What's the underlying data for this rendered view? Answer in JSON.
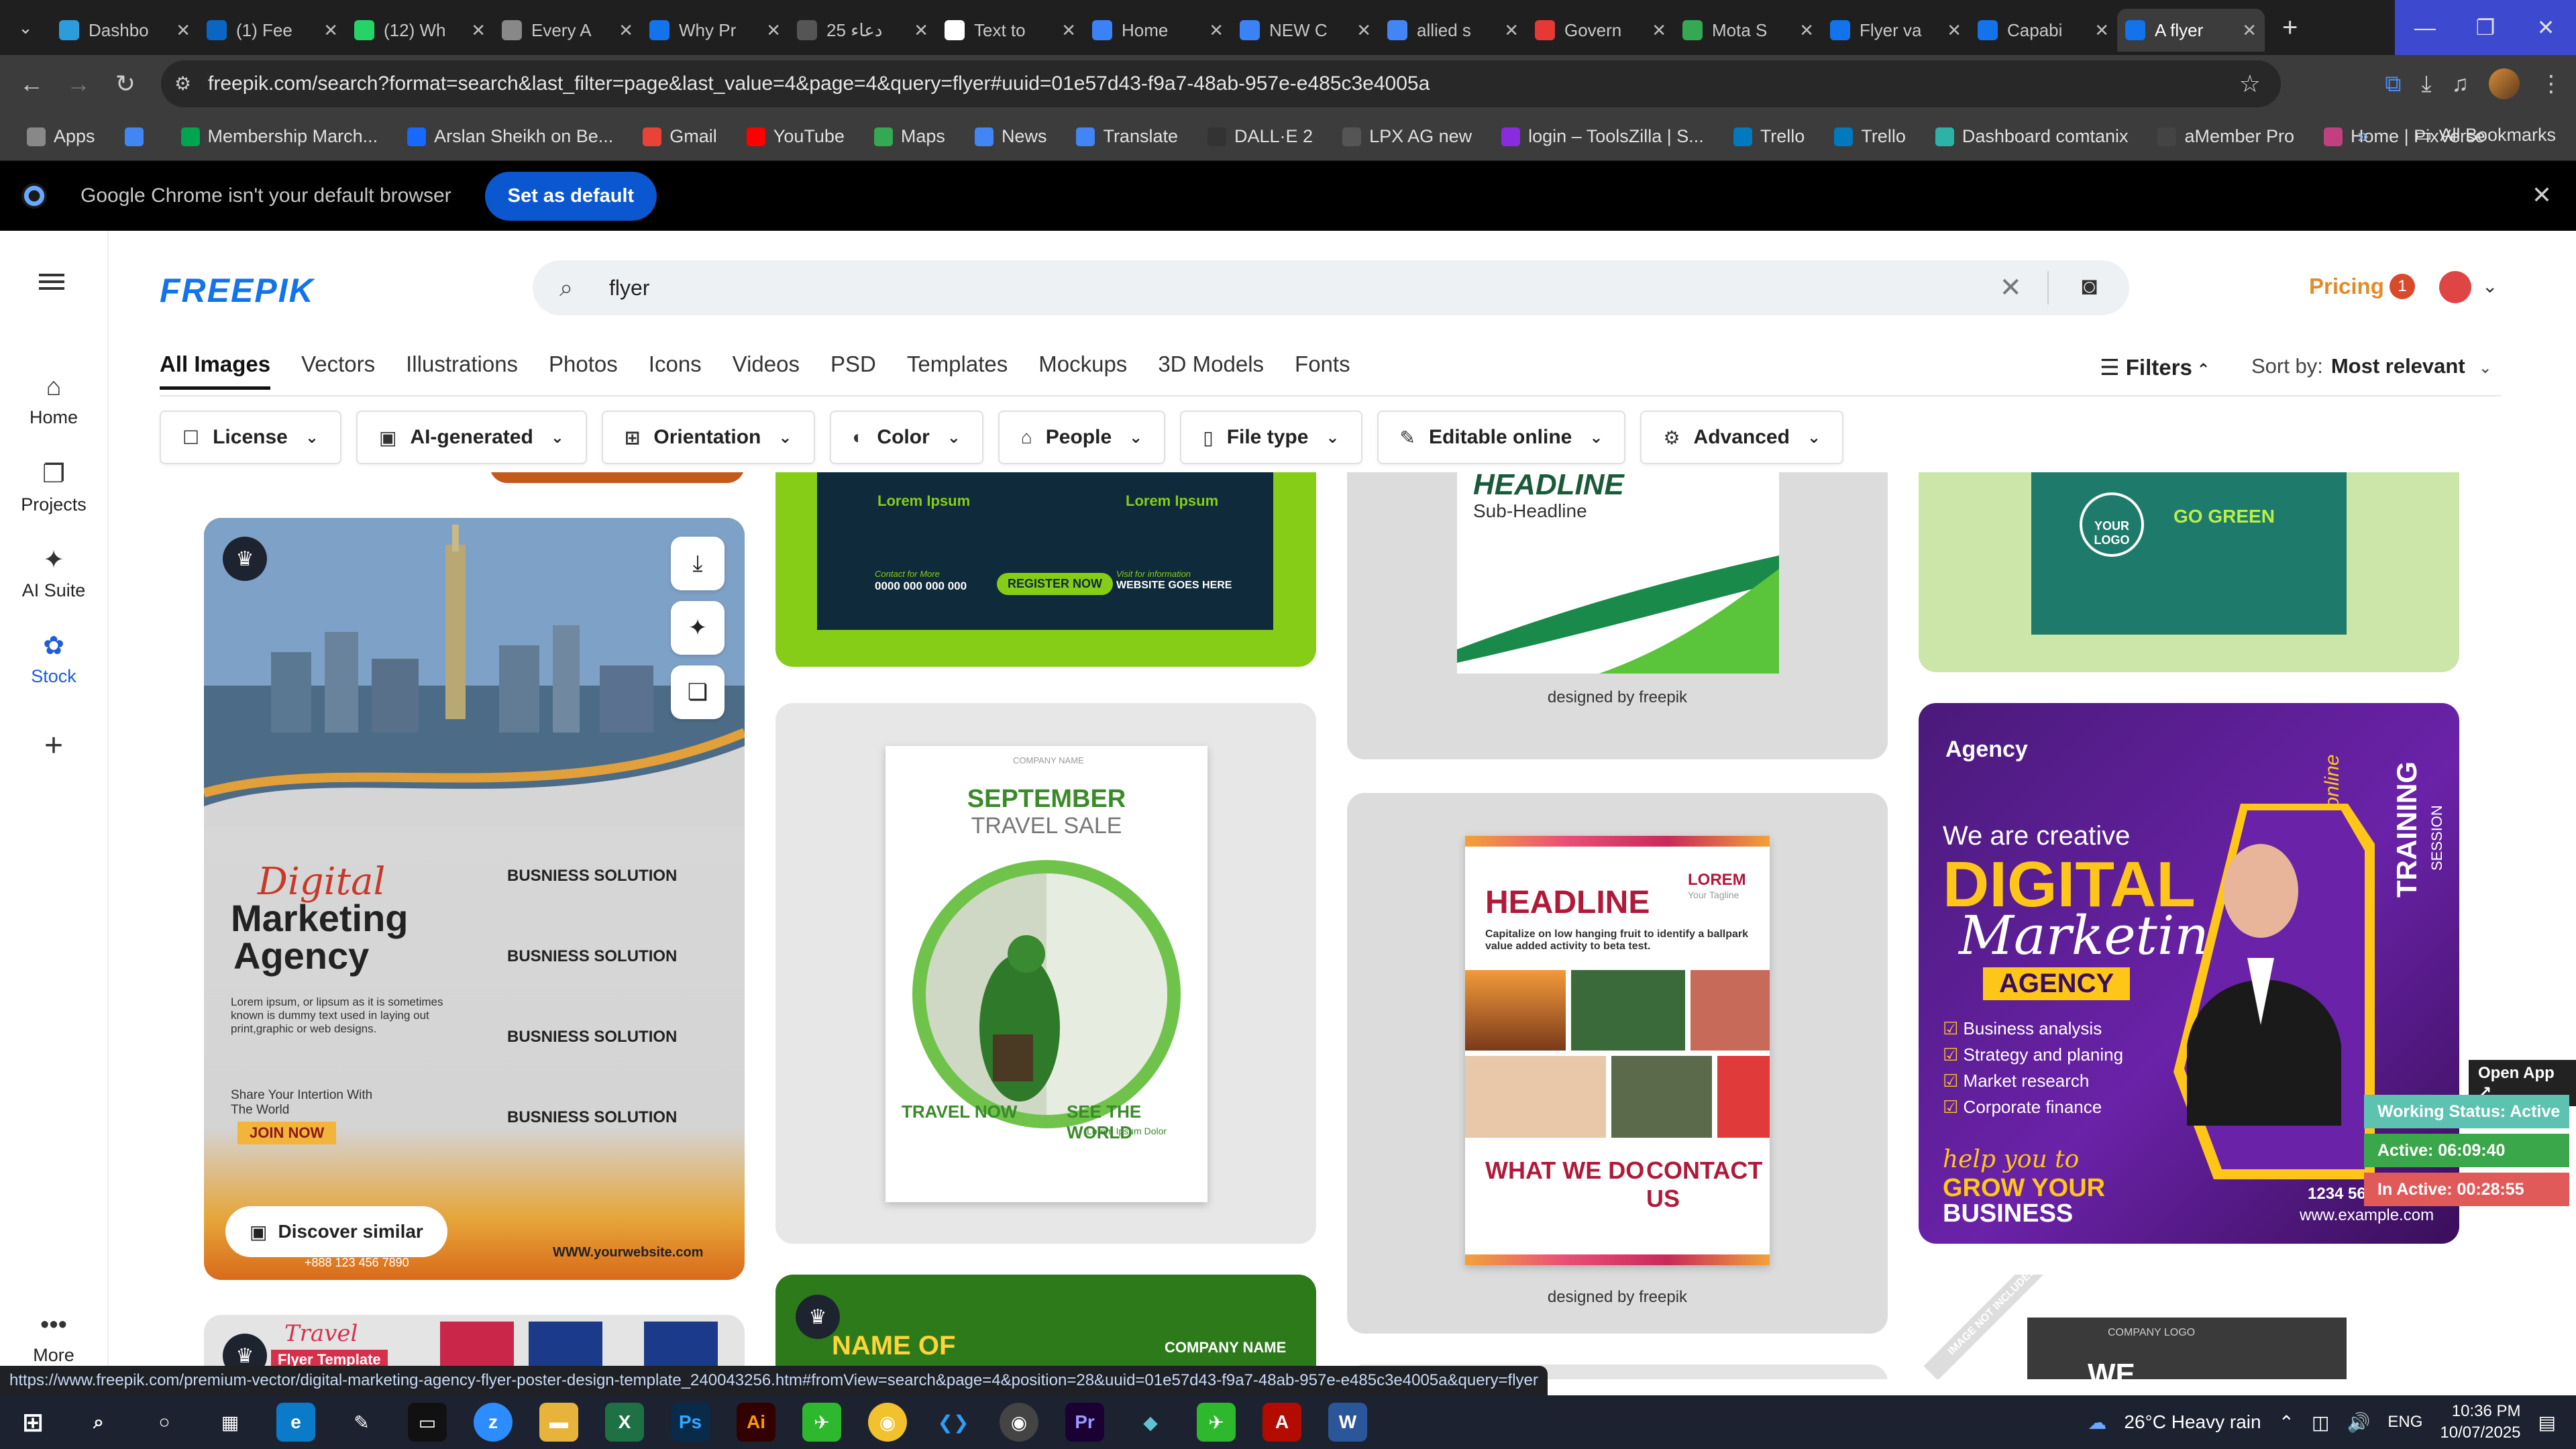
{
  "browser": {
    "tabs": [
      {
        "label": "Dashbo",
        "color": "#2d9cdb"
      },
      {
        "label": "(1) Fee",
        "color": "#0a66c2"
      },
      {
        "label": "(12) Wh",
        "color": "#25d366"
      },
      {
        "label": "Every A",
        "color": "#888888"
      },
      {
        "label": "Why Pr",
        "color": "#1273eb"
      },
      {
        "label": "25 دعاء",
        "color": "#555555"
      },
      {
        "label": "Text to",
        "color": "#ffffff"
      },
      {
        "label": "Home",
        "color": "#3b82f6"
      },
      {
        "label": "NEW C",
        "color": "#3b82f6"
      },
      {
        "label": "allied s",
        "color": "#4285f4"
      },
      {
        "label": "Govern",
        "color": "#e53935"
      },
      {
        "label": "Mota S",
        "color": "#34a853"
      },
      {
        "label": "Flyer va",
        "color": "#1273eb"
      },
      {
        "label": "Capabi",
        "color": "#1273eb"
      },
      {
        "label": "A flyer",
        "color": "#1273eb"
      }
    ],
    "url": "freepik.com/search?format=search&last_filter=page&last_value=4&page=4&query=flyer#uuid=01e57d43-f9a7-48ab-957e-e485c3e4005a",
    "bookmarks": [
      {
        "label": "Apps",
        "color": "#888"
      },
      {
        "label": "",
        "color": "#4285f4"
      },
      {
        "label": "Membership March...",
        "color": "#00a550"
      },
      {
        "label": "Arslan Sheikh on Be...",
        "color": "#1769ff"
      },
      {
        "label": "Gmail",
        "color": "#ea4335"
      },
      {
        "label": "YouTube",
        "color": "#ff0000"
      },
      {
        "label": "Maps",
        "color": "#34a853"
      },
      {
        "label": "News",
        "color": "#4285f4"
      },
      {
        "label": "Translate",
        "color": "#4285f4"
      },
      {
        "label": "DALL·E 2",
        "color": "#333"
      },
      {
        "label": "LPX AG new",
        "color": "#555"
      },
      {
        "label": "login – ToolsZilla | S...",
        "color": "#8a2be2"
      },
      {
        "label": "Trello",
        "color": "#0079bf"
      },
      {
        "label": "Trello",
        "color": "#0079bf"
      },
      {
        "label": "Dashboard comtanix",
        "color": "#2ab3a6"
      },
      {
        "label": "aMember Pro",
        "color": "#444"
      },
      {
        "label": "Home | PixVerse",
        "color": "#c04080"
      }
    ],
    "all_bookmarks": "All Bookmarks",
    "default_notice": "Google Chrome isn't your default browser",
    "set_default": "Set as default",
    "status_url": "https://www.freepik.com/premium-vector/digital-marketing-agency-flyer-poster-design-template_240043256.htm#fromView=search&page=4&position=28&uuid=01e57d43-f9a7-48ab-957e-e485c3e4005a&query=flyer"
  },
  "sidenav": {
    "home": "Home",
    "projects": "Projects",
    "ai_suite": "AI Suite",
    "stock": "Stock",
    "more": "More"
  },
  "header": {
    "logo": "FREEPIK",
    "search_value": "flyer",
    "pricing": "Pricing",
    "notif_count": "1"
  },
  "tabs": [
    "All Images",
    "Vectors",
    "Illustrations",
    "Photos",
    "Icons",
    "Videos",
    "PSD",
    "Templates",
    "Mockups",
    "3D Models",
    "Fonts"
  ],
  "filters_label": "Filters",
  "sort": {
    "label": "Sort by:",
    "value": "Most relevant"
  },
  "chips": [
    {
      "label": "License",
      "icon": "☐"
    },
    {
      "label": "AI-generated",
      "icon": "▣"
    },
    {
      "label": "Orientation",
      "icon": "⊞"
    },
    {
      "label": "Color",
      "icon": "◐"
    },
    {
      "label": "People",
      "icon": "⌂"
    },
    {
      "label": "File type",
      "icon": "▯"
    },
    {
      "label": "Editable online",
      "icon": "✎"
    },
    {
      "label": "Advanced",
      "icon": "⚙"
    }
  ],
  "cards": {
    "c1": {
      "title_script": "Digital",
      "title_line2": "Marketing",
      "title_line3": "Agency",
      "body": "Lorem ipsum, or lipsum as it is sometimes known is dummy text used in laying out print,graphic or web designs.",
      "services": [
        "BUSNIESS SOLUTION",
        "BUSNIESS SOLUTION",
        "BUSNIESS SOLUTION",
        "BUSNIESS SOLUTION"
      ],
      "share": "Share Your Intertion With The World",
      "join": "JOIN NOW",
      "phone": "+888 123 456 7890",
      "site": "WWW.yourwebsite.com",
      "discover": "Discover similar"
    },
    "c2_top": {
      "items": [
        "Lorem Ipsum",
        "Lorem Ipsum"
      ],
      "contact": "Contact for More",
      "phone": "0000 000 000 000",
      "register": "REGISTER NOW",
      "visit": "Visit for information",
      "website": "WEBSITE GOES HERE"
    },
    "c2": {
      "company": "COMPANY NAME",
      "title1": "SEPTEMBER",
      "title2": "TRAVEL SALE",
      "left": "TRAVEL NOW",
      "right": "SEE THE WORLD",
      "dolor": "Lorem Ipsum Dolor"
    },
    "c2_bottom": {
      "title": "NAME OF",
      "company": "COMPANY NAME"
    },
    "c3_top": {
      "headline": "HEADLINE",
      "sub": "Sub-Headline",
      "credit": "designed by freepik"
    },
    "c3": {
      "headline": "HEADLINE",
      "lorem": "LOREM",
      "tagline": "Your Tagline",
      "body": "Capitalize on low hanging fruit to identify a ballpark value added activity to beta test.",
      "what": "WHAT WE DO",
      "contact": "CONTACT US",
      "credit": "designed by freepik"
    },
    "c4_top": {
      "logo": "YOUR LOGO",
      "title": "GO GREEN"
    },
    "c4": {
      "agency": "Agency",
      "line1": "We are creative",
      "big": "DIGITAL",
      "script": "Marketing",
      "band": "AGENCY",
      "list": [
        "Business analysis",
        "Strategy and planing",
        "Market research",
        "Corporate finance"
      ],
      "slogan1": "help you to",
      "slogan2": "GROW YOUR",
      "slogan3": "BUSINESS",
      "phone": "1234 5678 9000",
      "web": "www.example.com",
      "side1": "Join online",
      "side2": "TRAINING",
      "side3": "SESSION"
    },
    "c4_bottom": {
      "ribbon": "IMAGE NOT INCLUDED",
      "logo": "COMPANY LOGO",
      "title": "WE"
    },
    "c1_bottom": {
      "title": "Travel",
      "sub": "Flyer Template"
    }
  },
  "widget": {
    "open": "Open App ↗",
    "status": "Working Status: Active",
    "active": "Active: 06:09:40",
    "inactive": "In Active: 00:28:55"
  },
  "taskbar": {
    "weather": "26°C  Heavy rain",
    "lang": "ENG",
    "time": "10:36 PM",
    "date": "10/07/2025"
  }
}
